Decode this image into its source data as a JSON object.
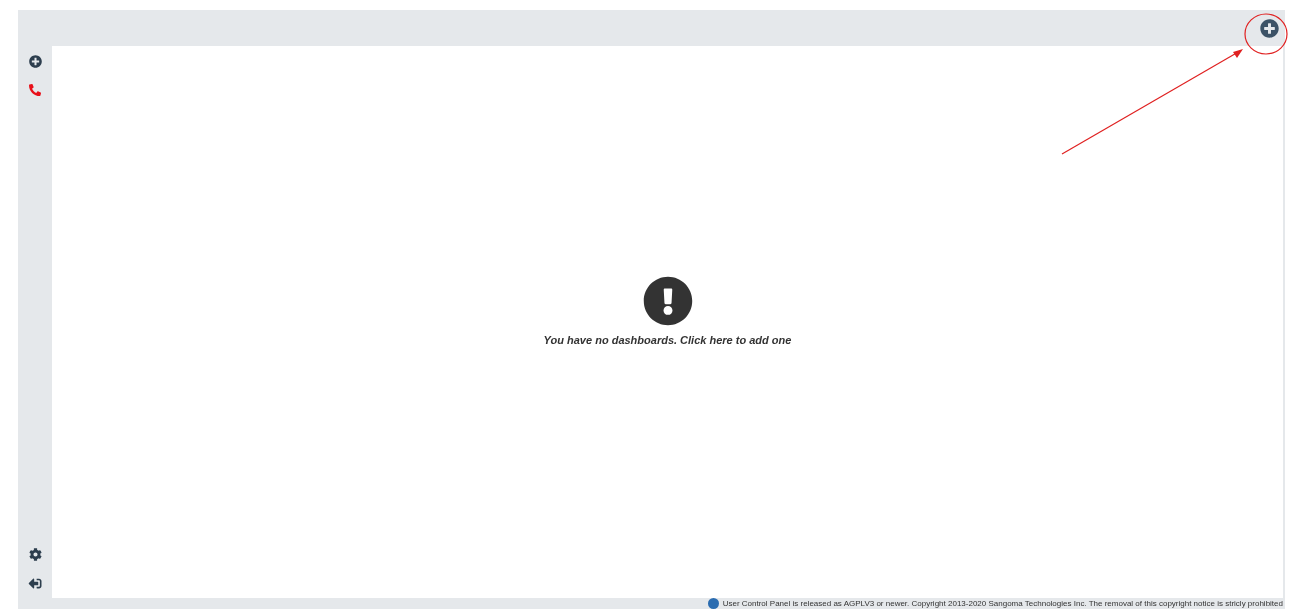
{
  "empty_state": {
    "message": "You have no dashboards. Click here to add one"
  },
  "footer": {
    "copyright": "User Control Panel is released as AGPLV3 or newer. Copyright 2013-2020 Sangoma Technologies Inc. The removal of this copyright notice is stricly prohibited"
  }
}
